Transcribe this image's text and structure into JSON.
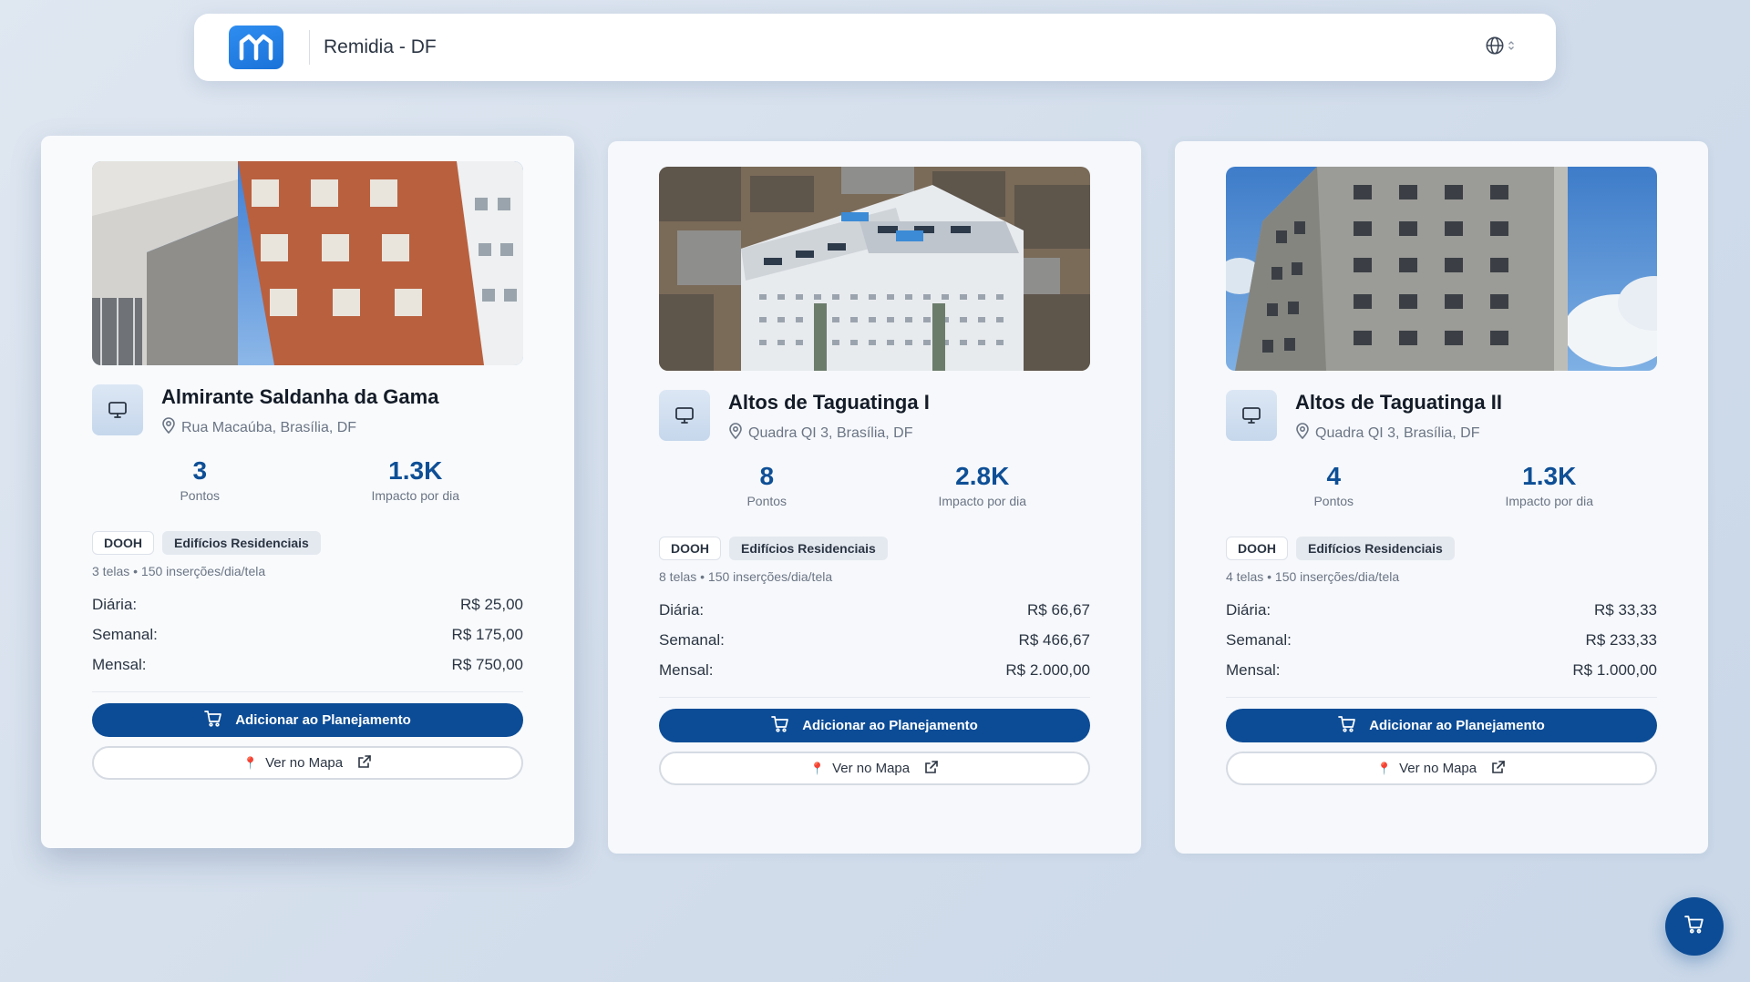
{
  "header": {
    "title": "Remidia - DF",
    "logo_icon": "remidia-logo-icon",
    "language_icon": "globe-icon"
  },
  "cards": [
    {
      "title": "Almirante Saldanha da Gama",
      "address": "Rua Macaúba, Brasília, DF",
      "stats": [
        {
          "value": "3",
          "label": "Pontos"
        },
        {
          "value": "1.3K",
          "label": "Impacto por dia"
        }
      ],
      "tags": [
        "DOOH",
        "Edifícios Residenciais"
      ],
      "meta": "3 telas • 150 inserções/dia/tela",
      "prices": [
        {
          "label": "Diária:",
          "value": "R$ 25,00"
        },
        {
          "label": "Semanal:",
          "value": "R$ 175,00"
        },
        {
          "label": "Mensal:",
          "value": "R$ 750,00"
        }
      ],
      "add_button": "Adicionar ao Planejamento",
      "map_button": "Ver no Mapa"
    },
    {
      "title": "Altos de Taguatinga I",
      "address": "Quadra QI 3, Brasília, DF",
      "stats": [
        {
          "value": "8",
          "label": "Pontos"
        },
        {
          "value": "2.8K",
          "label": "Impacto por dia"
        }
      ],
      "tags": [
        "DOOH",
        "Edifícios Residenciais"
      ],
      "meta": "8 telas • 150 inserções/dia/tela",
      "prices": [
        {
          "label": "Diária:",
          "value": "R$ 66,67"
        },
        {
          "label": "Semanal:",
          "value": "R$ 466,67"
        },
        {
          "label": "Mensal:",
          "value": "R$ 2.000,00"
        }
      ],
      "add_button": "Adicionar ao Planejamento",
      "map_button": "Ver no Mapa"
    },
    {
      "title": "Altos de Taguatinga II",
      "address": "Quadra QI 3, Brasília, DF",
      "stats": [
        {
          "value": "4",
          "label": "Pontos"
        },
        {
          "value": "1.3K",
          "label": "Impacto por dia"
        }
      ],
      "tags": [
        "DOOH",
        "Edifícios Residenciais"
      ],
      "meta": "4 telas • 150 inserções/dia/tela",
      "prices": [
        {
          "label": "Diária:",
          "value": "R$ 33,33"
        },
        {
          "label": "Semanal:",
          "value": "R$ 233,33"
        },
        {
          "label": "Mensal:",
          "value": "R$ 1.000,00"
        }
      ],
      "add_button": "Adicionar ao Planejamento",
      "map_button": "Ver no Mapa"
    }
  ],
  "colors": {
    "primary": "#0c4c96",
    "stat_value": "#0e4f96",
    "logo": "#1a72d8"
  },
  "fab_icon": "cart-icon"
}
